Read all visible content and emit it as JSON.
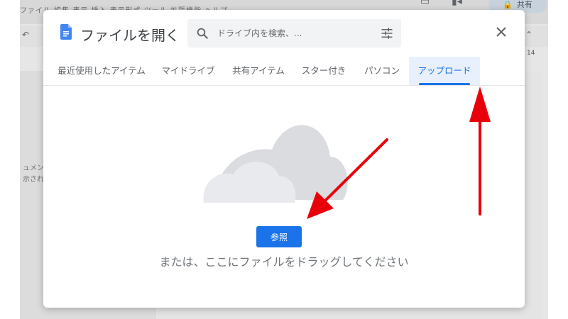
{
  "background": {
    "menu_text": "ファイル 編集 表示 挿入 表示形式 ツール 拡張機能 ヘルプ",
    "share_label": "共有",
    "ruler_number": "14",
    "doc_text_line1": "ュメン",
    "doc_text_line2": "示され"
  },
  "dialog": {
    "title": "ファイルを開く",
    "search_placeholder": "ドライブ内を検索、...",
    "browse_label": "参照",
    "drag_hint": "または、ここにファイルをドラッグしてください",
    "tabs": [
      {
        "label": "最近使用したアイテム",
        "active": false
      },
      {
        "label": "マイドライブ",
        "active": false
      },
      {
        "label": "共有アイテム",
        "active": false
      },
      {
        "label": "スター付き",
        "active": false
      },
      {
        "label": "パソコン",
        "active": false
      },
      {
        "label": "アップロード",
        "active": true
      }
    ]
  },
  "icons": {
    "doc": "google-docs-icon",
    "search": "search-icon",
    "filter": "tune-icon",
    "close": "close-icon",
    "cloud": "cloud-illustration"
  },
  "colors": {
    "accent": "#1a73e8",
    "active_tab_bg": "#e8f0fe",
    "annotation": "#e8000b"
  }
}
